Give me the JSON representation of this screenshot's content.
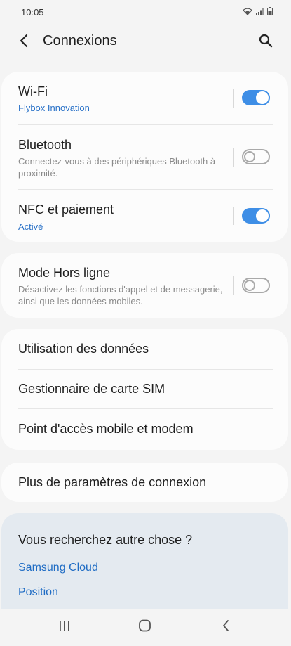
{
  "status_bar": {
    "time": "10:05"
  },
  "app_bar": {
    "title": "Connexions"
  },
  "group1": [
    {
      "title": "Wi-Fi",
      "subtitle": "Flybox Innovation",
      "subtitle_style": "accent",
      "toggle": "on"
    },
    {
      "title": "Bluetooth",
      "subtitle": "Connectez-vous à des périphériques Bluetooth à proximité.",
      "subtitle_style": "muted",
      "toggle": "off"
    },
    {
      "title": "NFC et paiement",
      "subtitle": "Activé",
      "subtitle_style": "accent",
      "toggle": "on"
    }
  ],
  "group2": [
    {
      "title": "Mode Hors ligne",
      "subtitle": "Désactivez les fonctions d'appel et de messagerie, ainsi que les données mobiles.",
      "toggle": "off"
    }
  ],
  "group3": [
    {
      "title": "Utilisation des données"
    },
    {
      "title": "Gestionnaire de carte SIM"
    },
    {
      "title": "Point d'accès mobile et modem"
    }
  ],
  "group4": [
    {
      "title": "Plus de paramètres de connexion"
    }
  ],
  "search_suggestions": {
    "title": "Vous recherchez autre chose ?",
    "links": [
      "Samsung Cloud",
      "Position"
    ]
  },
  "colors": {
    "accent": "#3e8ee6",
    "link": "#1f6cc4",
    "background": "#f4f4f4",
    "card": "#fcfcfc",
    "suggestion_card": "#e4eaf0"
  },
  "icons": [
    "wifi-icon",
    "signal-icon",
    "battery-icon",
    "back-arrow-icon",
    "search-icon",
    "recent-apps-icon",
    "home-icon",
    "nav-back-icon"
  ]
}
